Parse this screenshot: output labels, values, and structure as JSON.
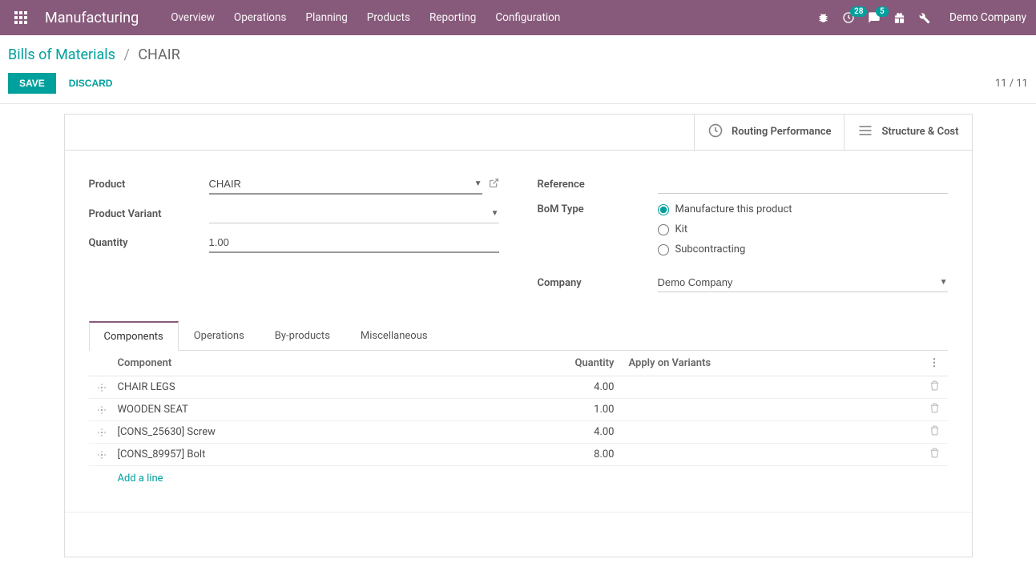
{
  "header": {
    "app": "Manufacturing",
    "menu": [
      "Overview",
      "Operations",
      "Planning",
      "Products",
      "Reporting",
      "Configuration"
    ],
    "badges": {
      "clock": "28",
      "chat": "5"
    },
    "company": "Demo Company"
  },
  "breadcrumb": {
    "root": "Bills of Materials",
    "current": "CHAIR"
  },
  "actions": {
    "save": "SAVE",
    "discard": "DISCARD"
  },
  "pager": "11 / 11",
  "statbuttons": {
    "routing": "Routing Performance",
    "structure": "Structure & Cost"
  },
  "form": {
    "labels": {
      "product": "Product",
      "variant": "Product Variant",
      "quantity": "Quantity",
      "reference": "Reference",
      "bom_type": "BoM Type",
      "company": "Company"
    },
    "values": {
      "product": "CHAIR",
      "variant": "",
      "quantity": "1.00",
      "reference": "",
      "company": "Demo Company"
    },
    "bom_type_options": {
      "manufacture": "Manufacture this product",
      "kit": "Kit",
      "subcontracting": "Subcontracting"
    }
  },
  "notebook": {
    "tabs": [
      "Components",
      "Operations",
      "By-products",
      "Miscellaneous"
    ],
    "columns": {
      "component": "Component",
      "quantity": "Quantity",
      "variants": "Apply on Variants"
    },
    "rows": [
      {
        "name": "CHAIR LEGS",
        "qty": "4.00"
      },
      {
        "name": "WOODEN SEAT",
        "qty": "1.00"
      },
      {
        "name": "[CONS_25630] Screw",
        "qty": "4.00"
      },
      {
        "name": "[CONS_89957] Bolt",
        "qty": "8.00"
      }
    ],
    "add_line": "Add a line"
  }
}
